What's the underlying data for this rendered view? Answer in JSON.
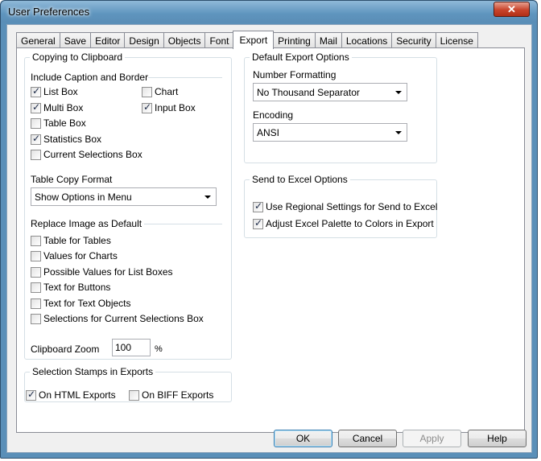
{
  "window": {
    "title": "User Preferences",
    "close_symbol": "✕"
  },
  "tabs": [
    "General",
    "Save",
    "Editor",
    "Design",
    "Objects",
    "Font",
    "Export",
    "Printing",
    "Mail",
    "Locations",
    "Security",
    "License"
  ],
  "active_tab": "Export",
  "copying": {
    "legend": "Copying to Clipboard",
    "caption_section": "Include Caption and Border",
    "list_box": "List Box",
    "multi_box": "Multi Box",
    "table_box": "Table Box",
    "statistics_box": "Statistics Box",
    "current_selections_box": "Current Selections Box",
    "chart": "Chart",
    "input_box": "Input Box",
    "table_copy_format_label": "Table Copy Format",
    "table_copy_format_value": "Show Options in Menu",
    "replace_section": "Replace Image as Default",
    "table_for_tables": "Table for Tables",
    "values_for_charts": "Values for Charts",
    "possible_values": "Possible Values for List Boxes",
    "text_for_buttons": "Text for Buttons",
    "text_for_text_objects": "Text for Text Objects",
    "selections_for_current": "Selections for Current Selections Box",
    "zoom_label": "Clipboard Zoom",
    "zoom_value": "100",
    "zoom_unit": "%"
  },
  "stamps": {
    "legend": "Selection Stamps in Exports",
    "html": "On HTML Exports",
    "biff": "On BIFF Exports"
  },
  "default_export": {
    "legend": "Default Export Options",
    "number_formatting_label": "Number Formatting",
    "number_formatting_value": "No Thousand Separator",
    "encoding_label": "Encoding",
    "encoding_value": "ANSI"
  },
  "excel": {
    "legend": "Send to Excel Options",
    "regional": "Use Regional Settings for Send to Excel",
    "palette": "Adjust Excel Palette to Colors in Export"
  },
  "buttons": {
    "ok": "OK",
    "cancel": "Cancel",
    "apply": "Apply",
    "help": "Help"
  }
}
